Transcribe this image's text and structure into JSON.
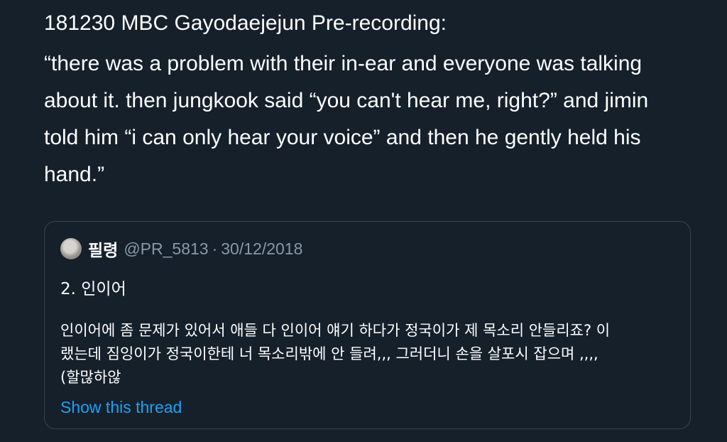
{
  "tweet": {
    "headline": "181230 MBC Gayodaejejun Pre-recording:",
    "body": "“there was a problem with their in-ear and everyone was talking about it. then jungkook said “you can't hear me, right?” and jimin told him “i can only hear your voice” and then he gently held his hand.”"
  },
  "quoted_tweet": {
    "display_name": "필령",
    "handle": "@PR_5813",
    "separator": "·",
    "date": "30/12/2018",
    "line1": "2. 인이어",
    "text_lines": [
      "인이어에 좀 문제가 있어서 애들 다 인이어 얘기 하다가 정국이가 제 목소리 안들리죠? 이",
      "랬는데 짐잉이가 정국이한테 너 목소리밖에 안 들려,,, 그러더니 손을 살포시 잡으며 ,,,,",
      "(할많하않"
    ],
    "thread_link": "Show this thread"
  },
  "colors": {
    "background": "#15202b",
    "text": "#ffffff",
    "secondary_text": "#8899a6",
    "border": "#38444d",
    "link": "#1da1f2"
  }
}
